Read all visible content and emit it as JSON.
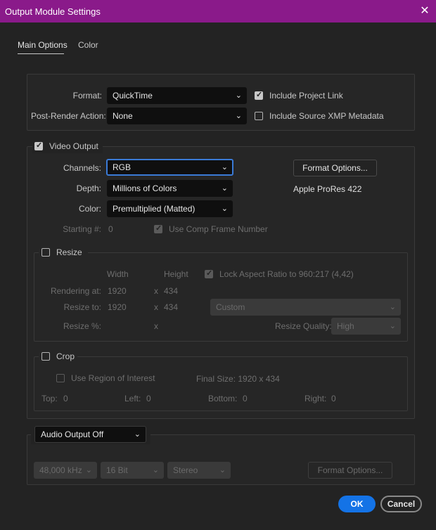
{
  "window": {
    "title": "Output Module Settings"
  },
  "tabs": [
    {
      "label": "Main Options"
    },
    {
      "label": "Color"
    }
  ],
  "format_section": {
    "format_label": "Format:",
    "format_value": "QuickTime",
    "post_render_label": "Post-Render Action:",
    "post_render_value": "None",
    "include_project_link": {
      "label": "Include Project Link",
      "checked": true
    },
    "include_xmp": {
      "label": "Include Source XMP Metadata",
      "checked": false
    }
  },
  "video_output": {
    "label": "Video Output",
    "checked": true,
    "channels_label": "Channels:",
    "channels_value": "RGB",
    "depth_label": "Depth:",
    "depth_value": "Millions of Colors",
    "color_label": "Color:",
    "color_value": "Premultiplied (Matted)",
    "starting_label": "Starting #:",
    "starting_value": "0",
    "use_comp_frame": {
      "label": "Use Comp Frame Number",
      "checked": true
    },
    "format_options_label": "Format Options...",
    "codec": "Apple ProRes 422"
  },
  "resize": {
    "label": "Resize",
    "checked": false,
    "width_header": "Width",
    "height_header": "Height",
    "lock_aspect": {
      "label": "Lock Aspect Ratio to 960:217 (4,42)",
      "checked": true
    },
    "rendering_label": "Rendering at:",
    "rendering_w": "1920",
    "rendering_h": "434",
    "resize_to_label": "Resize to:",
    "resize_to_w": "1920",
    "resize_to_h": "434",
    "preset_value": "Custom",
    "resize_pct_label": "Resize %:",
    "x_sep": "x",
    "quality_label": "Resize Quality:",
    "quality_value": "High"
  },
  "crop": {
    "label": "Crop",
    "checked": false,
    "use_roi": {
      "label": "Use Region of Interest",
      "checked": false
    },
    "final_size": "Final Size: 1920 x 434",
    "top_label": "Top:",
    "top_value": "0",
    "left_label": "Left:",
    "left_value": "0",
    "bottom_label": "Bottom:",
    "bottom_value": "0",
    "right_label": "Right:",
    "right_value": "0"
  },
  "audio": {
    "output_value": "Audio Output Off",
    "rate_value": "48,000 kHz",
    "bits_value": "16 Bit",
    "channels_value": "Stereo",
    "format_options_label": "Format Options..."
  },
  "footer": {
    "ok_label": "OK",
    "cancel_label": "Cancel"
  },
  "colors": {
    "titlebar": "#8a1a8a",
    "accent": "#1473e6",
    "focus": "#3a7ad6"
  },
  "icons": {
    "close": "close-icon",
    "dropdown": "chevron-down-icon",
    "check": "check-icon"
  }
}
